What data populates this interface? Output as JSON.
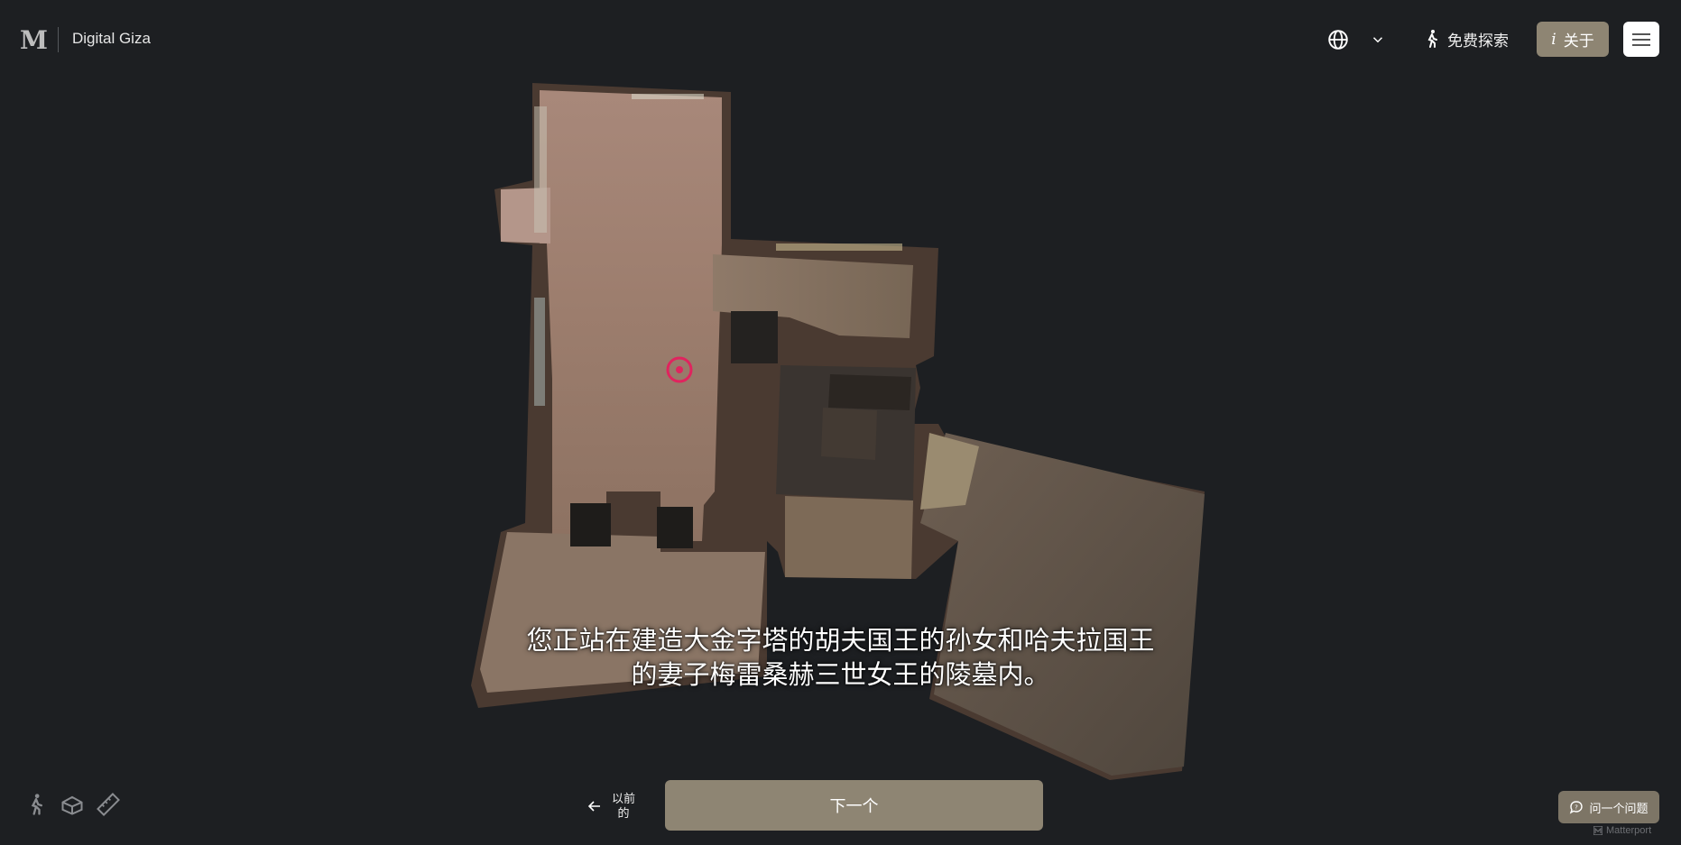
{
  "header": {
    "logo_mark": "M",
    "site_name": "Digital Giza",
    "explore_label": "免费探索",
    "about_label": "关于",
    "about_icon": "i"
  },
  "icons": {
    "language": "globe-icon",
    "language_menu": "chevron-down-icon",
    "explore": "walking-person-icon",
    "menu": "hamburger-icon",
    "tools": [
      "walking-person-icon",
      "dollhouse-icon",
      "ruler-icon"
    ],
    "ask": "chat-bubble-icon"
  },
  "caption": {
    "line1": "您正站在建造大金字塔的胡夫国王的孙女和哈夫拉国王",
    "line2": "的妻子梅雷桑赫三世女王的陵墓内。"
  },
  "footer": {
    "prev_line1": "以前",
    "prev_line2": "的",
    "next_label": "下一个",
    "ask_label": "问一个问题",
    "brand": "Matterport"
  },
  "colors": {
    "background": "#1d1f22",
    "accent": "#8e8573",
    "marker": "#e0245e"
  }
}
